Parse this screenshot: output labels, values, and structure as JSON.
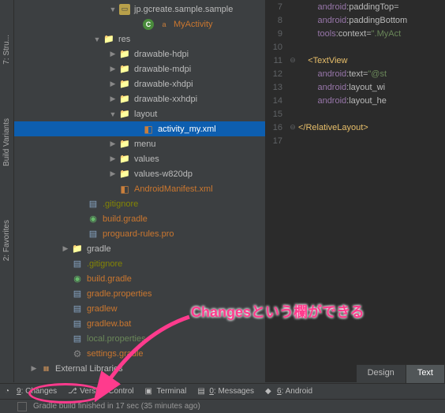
{
  "leftTabs": [
    {
      "label": "7: Stru..."
    },
    {
      "label": "Build Variants"
    },
    {
      "label": "2: Favorites"
    }
  ],
  "tree": {
    "pkg": "jp.gcreate.sample.sample",
    "activity": "MyActivity",
    "res": "res",
    "drawables": [
      "drawable-hdpi",
      "drawable-mdpi",
      "drawable-xhdpi",
      "drawable-xxhdpi"
    ],
    "layout": "layout",
    "layout_file": "activity_my.xml",
    "menu": "menu",
    "values": "values",
    "values_w": "values-w820dp",
    "manifest": "AndroidManifest.xml",
    "gitignore": ".gitignore",
    "buildgradle": "build.gradle",
    "proguard": "proguard-rules.pro",
    "gradle_dir": "gradle",
    "root_gitignore": ".gitignore",
    "root_buildgradle": "build.gradle",
    "gradle_props": "gradle.properties",
    "local_props": "local.properties",
    "gradlew": "gradlew",
    "gradlew_bat": "gradlew.bat",
    "settings_gradle": "settings.gradle",
    "ext_libs": "External Libraries"
  },
  "editor": {
    "lines": [
      {
        "n": 7,
        "g": "",
        "html": "        <span class='ns'>android</span><span class='attr'>:paddingTop=</span>"
      },
      {
        "n": 8,
        "g": "",
        "html": "        <span class='ns'>android</span><span class='attr'>:paddingBottom</span>"
      },
      {
        "n": 9,
        "g": "",
        "html": "        <span class='ns'>tools</span><span class='attr'>:context=</span><span class='str'>\".MyAct</span>"
      },
      {
        "n": 10,
        "g": "",
        "html": ""
      },
      {
        "n": 11,
        "g": "⊖",
        "html": "    <span class='tag'>&lt;TextView</span>"
      },
      {
        "n": 12,
        "g": "",
        "html": "        <span class='ns'>android</span><span class='attr'>:text=</span><span class='str'>\"@st</span>"
      },
      {
        "n": 13,
        "g": "",
        "html": "        <span class='ns'>android</span><span class='attr'>:layout_wi</span>"
      },
      {
        "n": 14,
        "g": "",
        "html": "        <span class='ns'>android</span><span class='attr'>:layout_he</span>"
      },
      {
        "n": 15,
        "g": "",
        "html": ""
      },
      {
        "n": 16,
        "g": "⊖",
        "html": "<span class='tag'>&lt;/RelativeLayout&gt;</span>"
      },
      {
        "n": 17,
        "g": "",
        "html": ""
      }
    ]
  },
  "editorTabs": {
    "design": "Design",
    "text": "Text"
  },
  "bottomTools": [
    {
      "key": "9",
      "label": "Changes",
      "icon": "changes"
    },
    {
      "key": "",
      "label": "Version Control",
      "icon": "vcs"
    },
    {
      "key": "",
      "label": "Terminal",
      "icon": "terminal"
    },
    {
      "key": "0",
      "label": "Messages",
      "icon": "messages"
    },
    {
      "key": "6",
      "label": "Android",
      "icon": "android"
    }
  ],
  "status": "Gradle build finished in 17 sec (35 minutes ago)",
  "callout": "Changesという欄ができる"
}
